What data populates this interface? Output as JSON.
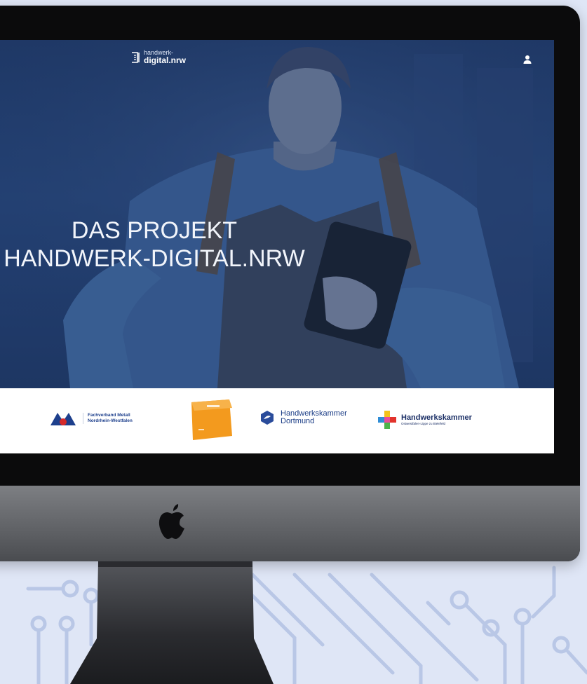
{
  "colors": {
    "background": "#dfe6f6",
    "circuit_lines": "#b9c7e6",
    "hero_overlay": "#1f3866",
    "monitor_bezel": "#0b0b0c",
    "chin": "#6a6c70",
    "accent_blue": "#1d3f8c",
    "accent_orange": "#f39a1e"
  },
  "site": {
    "brand_top": "handwerk-",
    "brand_bottom": "digital.nrw",
    "user_icon": "user-icon"
  },
  "hero": {
    "title_line1": "DAS PROJEKT",
    "title_line2": "HANDWERK-DIGITAL.NRW"
  },
  "partners": {
    "fvm_line1": "Fachverband Metall",
    "fvm_line2": "Nordrhein-Westfalen",
    "hwk_do_line1": "Handwerkskammer",
    "hwk_do_line2": "Dortmund",
    "hwk_bi_title": "Handwerkskammer",
    "hwk_bi_sub": "Ostwestfalen-Lippe zu Bielefeld"
  },
  "device": {
    "logo": "apple-logo"
  }
}
